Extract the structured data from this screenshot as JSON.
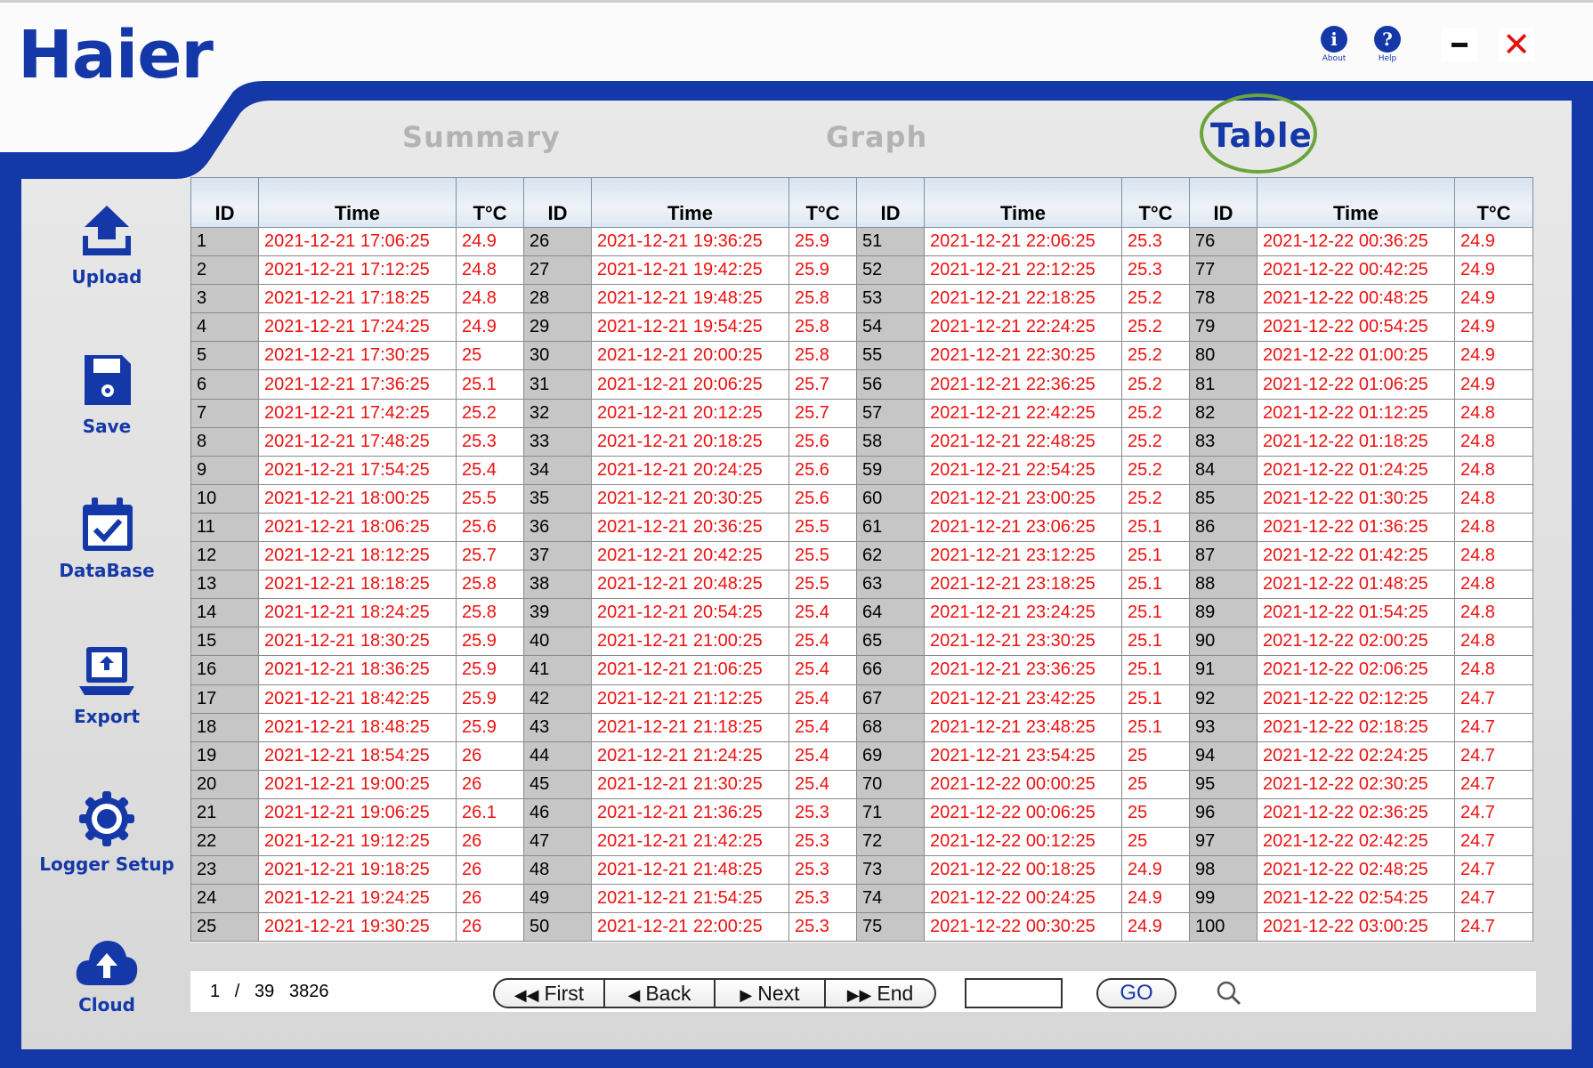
{
  "app": {
    "logo": "Haier",
    "top_buttons": {
      "about": "About",
      "help": "Help",
      "about_glyph": "i",
      "help_glyph": "?",
      "close_glyph": "✕"
    },
    "colors": {
      "brand_blue": "#1538a8",
      "value_red": "#ee1111",
      "tab_highlight": "#6aa43a"
    }
  },
  "tabs": [
    {
      "label": "Summary",
      "active": false
    },
    {
      "label": "Graph",
      "active": false
    },
    {
      "label": "Table",
      "active": true
    }
  ],
  "sidebar": [
    {
      "label": "Upload",
      "icon": "upload-icon"
    },
    {
      "label": "Save",
      "icon": "floppy-disk-icon"
    },
    {
      "label": "DataBase",
      "icon": "calendar-check-icon"
    },
    {
      "label": "Export",
      "icon": "laptop-export-icon"
    },
    {
      "label": "Logger Setup",
      "icon": "gear-icon"
    },
    {
      "label": "Cloud",
      "icon": "cloud-upload-icon"
    }
  ],
  "table": {
    "headers": [
      "ID",
      "Time",
      "T°C",
      "ID",
      "Time",
      "T°C",
      "ID",
      "Time",
      "T°C",
      "ID",
      "Time",
      "T°C"
    ],
    "blocks": [
      [
        [
          "1",
          "2021-12-21 17:06:25",
          "24.9"
        ],
        [
          "2",
          "2021-12-21 17:12:25",
          "24.8"
        ],
        [
          "3",
          "2021-12-21 17:18:25",
          "24.8"
        ],
        [
          "4",
          "2021-12-21 17:24:25",
          "24.9"
        ],
        [
          "5",
          "2021-12-21 17:30:25",
          "25"
        ],
        [
          "6",
          "2021-12-21 17:36:25",
          "25.1"
        ],
        [
          "7",
          "2021-12-21 17:42:25",
          "25.2"
        ],
        [
          "8",
          "2021-12-21 17:48:25",
          "25.3"
        ],
        [
          "9",
          "2021-12-21 17:54:25",
          "25.4"
        ],
        [
          "10",
          "2021-12-21 18:00:25",
          "25.5"
        ],
        [
          "11",
          "2021-12-21 18:06:25",
          "25.6"
        ],
        [
          "12",
          "2021-12-21 18:12:25",
          "25.7"
        ],
        [
          "13",
          "2021-12-21 18:18:25",
          "25.8"
        ],
        [
          "14",
          "2021-12-21 18:24:25",
          "25.8"
        ],
        [
          "15",
          "2021-12-21 18:30:25",
          "25.9"
        ],
        [
          "16",
          "2021-12-21 18:36:25",
          "25.9"
        ],
        [
          "17",
          "2021-12-21 18:42:25",
          "25.9"
        ],
        [
          "18",
          "2021-12-21 18:48:25",
          "25.9"
        ],
        [
          "19",
          "2021-12-21 18:54:25",
          "26"
        ],
        [
          "20",
          "2021-12-21 19:00:25",
          "26"
        ],
        [
          "21",
          "2021-12-21 19:06:25",
          "26.1"
        ],
        [
          "22",
          "2021-12-21 19:12:25",
          "26"
        ],
        [
          "23",
          "2021-12-21 19:18:25",
          "26"
        ],
        [
          "24",
          "2021-12-21 19:24:25",
          "26"
        ],
        [
          "25",
          "2021-12-21 19:30:25",
          "26"
        ]
      ],
      [
        [
          "26",
          "2021-12-21 19:36:25",
          "25.9"
        ],
        [
          "27",
          "2021-12-21 19:42:25",
          "25.9"
        ],
        [
          "28",
          "2021-12-21 19:48:25",
          "25.8"
        ],
        [
          "29",
          "2021-12-21 19:54:25",
          "25.8"
        ],
        [
          "30",
          "2021-12-21 20:00:25",
          "25.8"
        ],
        [
          "31",
          "2021-12-21 20:06:25",
          "25.7"
        ],
        [
          "32",
          "2021-12-21 20:12:25",
          "25.7"
        ],
        [
          "33",
          "2021-12-21 20:18:25",
          "25.6"
        ],
        [
          "34",
          "2021-12-21 20:24:25",
          "25.6"
        ],
        [
          "35",
          "2021-12-21 20:30:25",
          "25.6"
        ],
        [
          "36",
          "2021-12-21 20:36:25",
          "25.5"
        ],
        [
          "37",
          "2021-12-21 20:42:25",
          "25.5"
        ],
        [
          "38",
          "2021-12-21 20:48:25",
          "25.5"
        ],
        [
          "39",
          "2021-12-21 20:54:25",
          "25.4"
        ],
        [
          "40",
          "2021-12-21 21:00:25",
          "25.4"
        ],
        [
          "41",
          "2021-12-21 21:06:25",
          "25.4"
        ],
        [
          "42",
          "2021-12-21 21:12:25",
          "25.4"
        ],
        [
          "43",
          "2021-12-21 21:18:25",
          "25.4"
        ],
        [
          "44",
          "2021-12-21 21:24:25",
          "25.4"
        ],
        [
          "45",
          "2021-12-21 21:30:25",
          "25.4"
        ],
        [
          "46",
          "2021-12-21 21:36:25",
          "25.3"
        ],
        [
          "47",
          "2021-12-21 21:42:25",
          "25.3"
        ],
        [
          "48",
          "2021-12-21 21:48:25",
          "25.3"
        ],
        [
          "49",
          "2021-12-21 21:54:25",
          "25.3"
        ],
        [
          "50",
          "2021-12-21 22:00:25",
          "25.3"
        ]
      ],
      [
        [
          "51",
          "2021-12-21 22:06:25",
          "25.3"
        ],
        [
          "52",
          "2021-12-21 22:12:25",
          "25.3"
        ],
        [
          "53",
          "2021-12-21 22:18:25",
          "25.2"
        ],
        [
          "54",
          "2021-12-21 22:24:25",
          "25.2"
        ],
        [
          "55",
          "2021-12-21 22:30:25",
          "25.2"
        ],
        [
          "56",
          "2021-12-21 22:36:25",
          "25.2"
        ],
        [
          "57",
          "2021-12-21 22:42:25",
          "25.2"
        ],
        [
          "58",
          "2021-12-21 22:48:25",
          "25.2"
        ],
        [
          "59",
          "2021-12-21 22:54:25",
          "25.2"
        ],
        [
          "60",
          "2021-12-21 23:00:25",
          "25.2"
        ],
        [
          "61",
          "2021-12-21 23:06:25",
          "25.1"
        ],
        [
          "62",
          "2021-12-21 23:12:25",
          "25.1"
        ],
        [
          "63",
          "2021-12-21 23:18:25",
          "25.1"
        ],
        [
          "64",
          "2021-12-21 23:24:25",
          "25.1"
        ],
        [
          "65",
          "2021-12-21 23:30:25",
          "25.1"
        ],
        [
          "66",
          "2021-12-21 23:36:25",
          "25.1"
        ],
        [
          "67",
          "2021-12-21 23:42:25",
          "25.1"
        ],
        [
          "68",
          "2021-12-21 23:48:25",
          "25.1"
        ],
        [
          "69",
          "2021-12-21 23:54:25",
          "25"
        ],
        [
          "70",
          "2021-12-22 00:00:25",
          "25"
        ],
        [
          "71",
          "2021-12-22 00:06:25",
          "25"
        ],
        [
          "72",
          "2021-12-22 00:12:25",
          "25"
        ],
        [
          "73",
          "2021-12-22 00:18:25",
          "24.9"
        ],
        [
          "74",
          "2021-12-22 00:24:25",
          "24.9"
        ],
        [
          "75",
          "2021-12-22 00:30:25",
          "24.9"
        ]
      ],
      [
        [
          "76",
          "2021-12-22 00:36:25",
          "24.9"
        ],
        [
          "77",
          "2021-12-22 00:42:25",
          "24.9"
        ],
        [
          "78",
          "2021-12-22 00:48:25",
          "24.9"
        ],
        [
          "79",
          "2021-12-22 00:54:25",
          "24.9"
        ],
        [
          "80",
          "2021-12-22 01:00:25",
          "24.9"
        ],
        [
          "81",
          "2021-12-22 01:06:25",
          "24.9"
        ],
        [
          "82",
          "2021-12-22 01:12:25",
          "24.8"
        ],
        [
          "83",
          "2021-12-22 01:18:25",
          "24.8"
        ],
        [
          "84",
          "2021-12-22 01:24:25",
          "24.8"
        ],
        [
          "85",
          "2021-12-22 01:30:25",
          "24.8"
        ],
        [
          "86",
          "2021-12-22 01:36:25",
          "24.8"
        ],
        [
          "87",
          "2021-12-22 01:42:25",
          "24.8"
        ],
        [
          "88",
          "2021-12-22 01:48:25",
          "24.8"
        ],
        [
          "89",
          "2021-12-22 01:54:25",
          "24.8"
        ],
        [
          "90",
          "2021-12-22 02:00:25",
          "24.8"
        ],
        [
          "91",
          "2021-12-22 02:06:25",
          "24.8"
        ],
        [
          "92",
          "2021-12-22 02:12:25",
          "24.7"
        ],
        [
          "93",
          "2021-12-22 02:18:25",
          "24.7"
        ],
        [
          "94",
          "2021-12-22 02:24:25",
          "24.7"
        ],
        [
          "95",
          "2021-12-22 02:30:25",
          "24.7"
        ],
        [
          "96",
          "2021-12-22 02:36:25",
          "24.7"
        ],
        [
          "97",
          "2021-12-22 02:42:25",
          "24.7"
        ],
        [
          "98",
          "2021-12-22 02:48:25",
          "24.7"
        ],
        [
          "99",
          "2021-12-22 02:54:25",
          "24.7"
        ],
        [
          "100",
          "2021-12-22 03:00:25",
          "24.7"
        ]
      ]
    ]
  },
  "pager": {
    "current_page": "1",
    "separator": "/",
    "total_pages": "39",
    "total_records": "3826",
    "first_label": "First",
    "back_label": "Back",
    "next_label": "Next",
    "end_label": "End",
    "first_glyph": "◀◀",
    "back_glyph": "◀",
    "next_glyph": "▶",
    "end_glyph": "▶▶",
    "goto_value": "",
    "go_label": "GO"
  }
}
